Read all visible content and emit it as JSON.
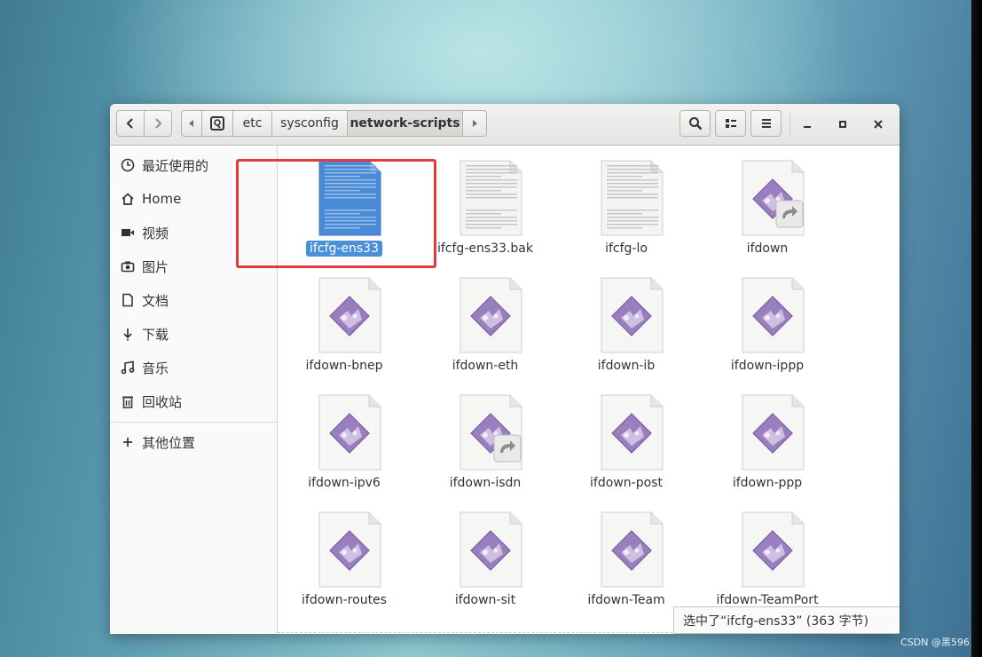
{
  "window": {
    "breadcrumb": [
      "etc",
      "sysconfig",
      "network-scripts"
    ]
  },
  "toolbar": {
    "back_icon": "chevron-left-icon",
    "forward_icon": "chevron-right-icon",
    "search_icon": "search-icon",
    "view_icon": "list-view-icon",
    "menu_icon": "hamburger-menu-icon",
    "minimize": "–",
    "maximize": "□",
    "close": "✕"
  },
  "sidebar": {
    "items": [
      {
        "label": "最近使用的",
        "icon": "clock-icon"
      },
      {
        "label": "Home",
        "icon": "home-icon"
      },
      {
        "label": "视频",
        "icon": "video-icon"
      },
      {
        "label": "图片",
        "icon": "camera-icon"
      },
      {
        "label": "文档",
        "icon": "document-icon"
      },
      {
        "label": "下载",
        "icon": "download-icon"
      },
      {
        "label": "音乐",
        "icon": "music-icon"
      },
      {
        "label": "回收站",
        "icon": "trash-icon"
      }
    ],
    "other": {
      "label": "其他位置",
      "icon": "plus-icon"
    }
  },
  "files": [
    {
      "name": "ifcfg-ens33",
      "type": "text",
      "selected": true
    },
    {
      "name": "ifcfg-ens33.bak",
      "type": "text",
      "selected": false
    },
    {
      "name": "ifcfg-lo",
      "type": "text",
      "selected": false
    },
    {
      "name": "ifdown",
      "type": "script-link",
      "selected": false
    },
    {
      "name": "ifdown-bnep",
      "type": "script",
      "selected": false
    },
    {
      "name": "ifdown-eth",
      "type": "script",
      "selected": false
    },
    {
      "name": "ifdown-ib",
      "type": "script",
      "selected": false
    },
    {
      "name": "ifdown-ippp",
      "type": "script",
      "selected": false
    },
    {
      "name": "ifdown-ipv6",
      "type": "script",
      "selected": false
    },
    {
      "name": "ifdown-isdn",
      "type": "script-link",
      "selected": false
    },
    {
      "name": "ifdown-post",
      "type": "script",
      "selected": false
    },
    {
      "name": "ifdown-ppp",
      "type": "script",
      "selected": false
    },
    {
      "name": "ifdown-routes",
      "type": "script",
      "selected": false
    },
    {
      "name": "ifdown-sit",
      "type": "script",
      "selected": false
    },
    {
      "name": "ifdown-Team",
      "type": "script",
      "selected": false
    },
    {
      "name": "ifdown-TeamPort",
      "type": "script",
      "selected": false
    }
  ],
  "status": {
    "text": "选中了“ifcfg-ens33” (363 字节)"
  },
  "watermark": "CSDN @黑596",
  "colors": {
    "selection": "#4a90d9",
    "highlight_box": "#e53a3a"
  }
}
